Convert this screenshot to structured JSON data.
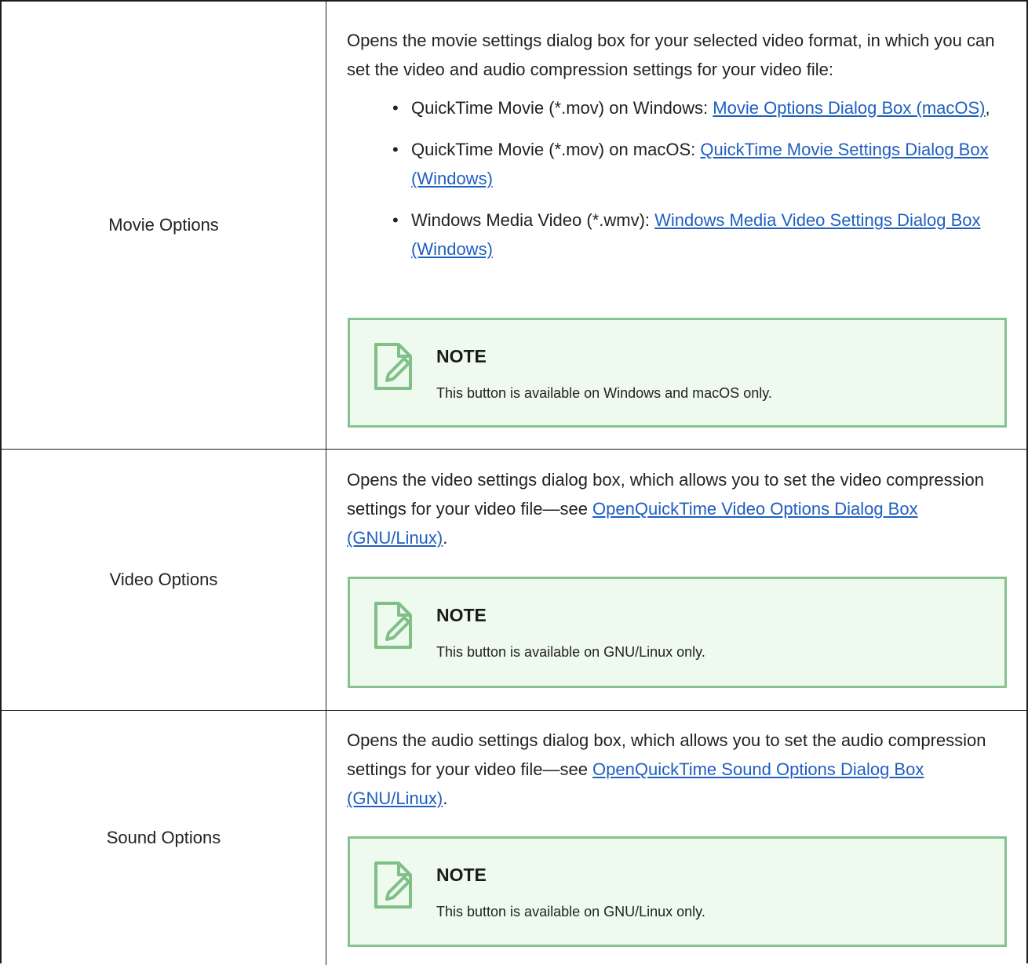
{
  "rows": [
    {
      "label": "Movie Options",
      "desc_line1": "Opens the movie settings dialog box for your selected video format, in which you can set the video and audio compression settings for your video file:",
      "bullets": [
        {
          "prefix": "QuickTime Movie (*.mov) on Windows: ",
          "link": "Movie Options Dialog Box (macOS)",
          "suffix": ","
        },
        {
          "prefix": "QuickTime Movie (*.mov) on macOS: ",
          "link": "QuickTime Movie Settings Dialog Box (Windows)",
          "suffix": ""
        },
        {
          "prefix": "Windows Media Video (*.wmv): ",
          "link": "Windows Media Video Settings Dialog Box (Windows)",
          "suffix": ""
        }
      ],
      "note_title": "NOTE",
      "note_text": "This button is available on Windows and macOS only."
    },
    {
      "label": "Video Options",
      "desc_prefix": "Opens the video settings dialog box, which allows you to set the video compression settings for your video file—see ",
      "desc_link": "OpenQuickTime Video Options Dialog Box (GNU/Linux)",
      "desc_suffix": ".",
      "note_title": "NOTE",
      "note_text": "This button is available on GNU/Linux only."
    },
    {
      "label": "Sound Options",
      "desc_prefix": "Opens the audio settings dialog box, which allows you to set the audio compression settings for your video file—see ",
      "desc_link": "OpenQuickTime Sound Options Dialog Box (GNU/Linux)",
      "desc_suffix": ".",
      "note_title": "NOTE",
      "note_text": "This button is available on GNU/Linux only."
    }
  ],
  "colors": {
    "link": "#1f5fbf",
    "note_bg": "#eefaee",
    "note_border": "#87c290",
    "note_icon": "#7fbf88"
  },
  "icons": {
    "note": "note-pencil-icon"
  }
}
